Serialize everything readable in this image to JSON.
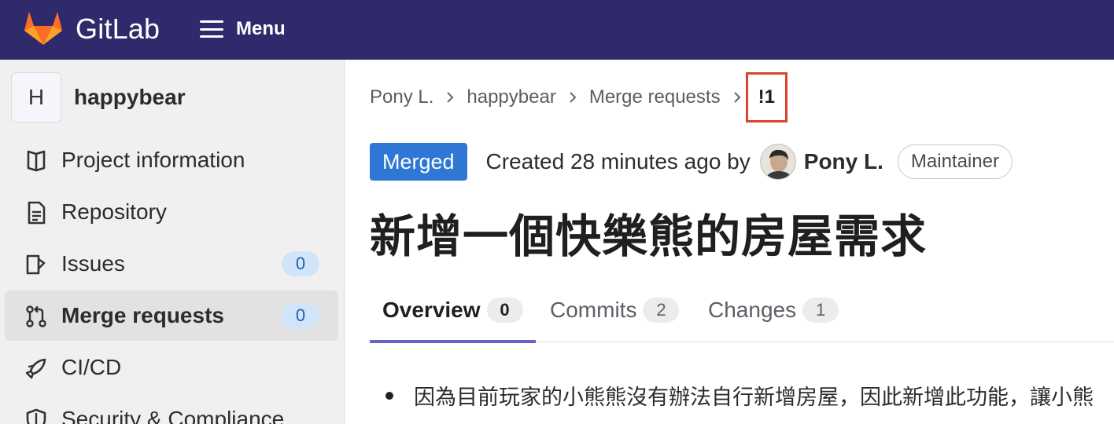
{
  "topbar": {
    "brand": "GitLab",
    "menu_label": "Menu",
    "colors": {
      "background": "#2f2a6b",
      "text": "#ffffff"
    }
  },
  "sidebar": {
    "project_initial": "H",
    "project_name": "happybear",
    "items": [
      {
        "label": "Project information",
        "icon": "project-information-icon",
        "active": false
      },
      {
        "label": "Repository",
        "icon": "repository-icon",
        "active": false
      },
      {
        "label": "Issues",
        "icon": "issues-icon",
        "badge": "0",
        "active": false
      },
      {
        "label": "Merge requests",
        "icon": "merge-request-icon",
        "badge": "0",
        "active": true
      },
      {
        "label": "CI/CD",
        "icon": "rocket-icon",
        "active": false
      },
      {
        "label": "Security & Compliance",
        "icon": "shield-icon",
        "active": false
      }
    ]
  },
  "breadcrumb": {
    "items": [
      "Pony L.",
      "happybear",
      "Merge requests"
    ],
    "current": "!1",
    "highlight_color": "#d9452b"
  },
  "mr": {
    "status": "Merged",
    "status_color": "#2f77d5",
    "created_text": "Created 28 minutes ago by",
    "author": "Pony L.",
    "author_role": "Maintainer",
    "title": "新增一個快樂熊的房屋需求"
  },
  "tabs": [
    {
      "label": "Overview",
      "count": "0",
      "active": true
    },
    {
      "label": "Commits",
      "count": "2",
      "active": false
    },
    {
      "label": "Changes",
      "count": "1",
      "active": false
    }
  ],
  "description": {
    "items": [
      "因為目前玩家的小熊熊沒有辦法自行新增房屋，因此新增此功能，讓小熊"
    ]
  }
}
